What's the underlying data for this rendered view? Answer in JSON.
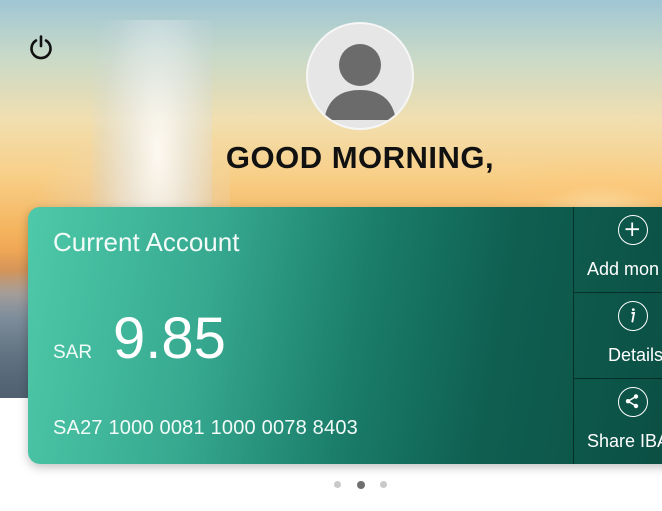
{
  "header": {
    "greeting": "GOOD MORNING,",
    "power_icon": "power-icon",
    "avatar_icon": "user-avatar-icon"
  },
  "account_card": {
    "title": "Current Account",
    "currency": "SAR",
    "balance": "9.85",
    "iban": "SA27 1000 0081 1000 0078 8403",
    "colors": {
      "start": "#4ec9a9",
      "end": "#0b4d42"
    }
  },
  "actions": [
    {
      "label": "Add mon",
      "icon": "plus-circle-icon"
    },
    {
      "label": "Details",
      "icon": "info-circle-icon"
    },
    {
      "label": "Share IBA",
      "icon": "share-circle-icon"
    }
  ],
  "pager": {
    "count": 3,
    "active_index": 1
  }
}
